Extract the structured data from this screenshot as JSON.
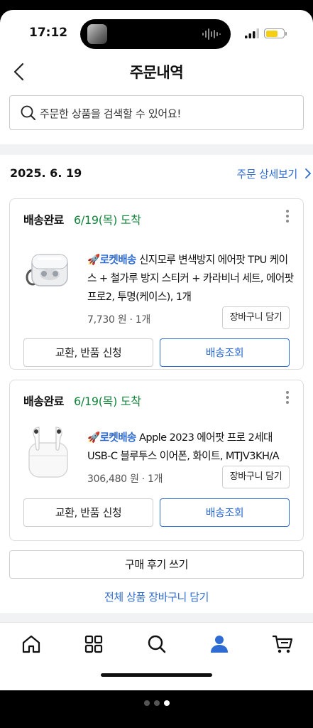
{
  "status_bar": {
    "time": "17:12",
    "battery_color": "#f5cf15"
  },
  "header": {
    "title": "주문내역"
  },
  "search": {
    "placeholder": "주문한 상품을 검색할 수 있어요!"
  },
  "order": {
    "date": "2025. 6. 19",
    "detail_link": "주문 상세보기"
  },
  "items": [
    {
      "status": "배송완료",
      "arrival": "6/19(목) 도착",
      "badge": "로켓배송",
      "name": "신지모루 변색방지 에어팟 TPU 케이스 + 철가루 방지 스티커 + 카라비너 세트, 에어팟 프로2, 투명(케이스), 1개",
      "price": "7,730 원",
      "qty": "1개",
      "cart_label": "장바구니 담기",
      "exchange_label": "교환, 반품 신청",
      "track_label": "배송조회"
    },
    {
      "status": "배송완료",
      "arrival": "6/19(목) 도착",
      "badge": "로켓배송",
      "name": "Apple 2023 에어팟 프로 2세대 USB-C 블루투스 이어폰, 화이트, MTJV3KH/A",
      "price": "306,480 원",
      "qty": "1개",
      "cart_label": "장바구니 담기",
      "exchange_label": "교환, 반품 신청",
      "track_label": "배송조회"
    }
  ],
  "footer": {
    "review_label": "구매 후기 쓰기",
    "all_cart_label": "전체 상품 장바구니 담기"
  },
  "tabbar": {
    "tabs": [
      "home-icon",
      "category-icon",
      "search-icon",
      "my-page-icon",
      "cart-icon"
    ],
    "active": "my-page-icon",
    "active_color": "#2e6bd3"
  },
  "colors": {
    "accent": "#2e6bd3",
    "arrival_green": "#12843b"
  },
  "page_indicator": {
    "count": 3,
    "active": 3
  }
}
